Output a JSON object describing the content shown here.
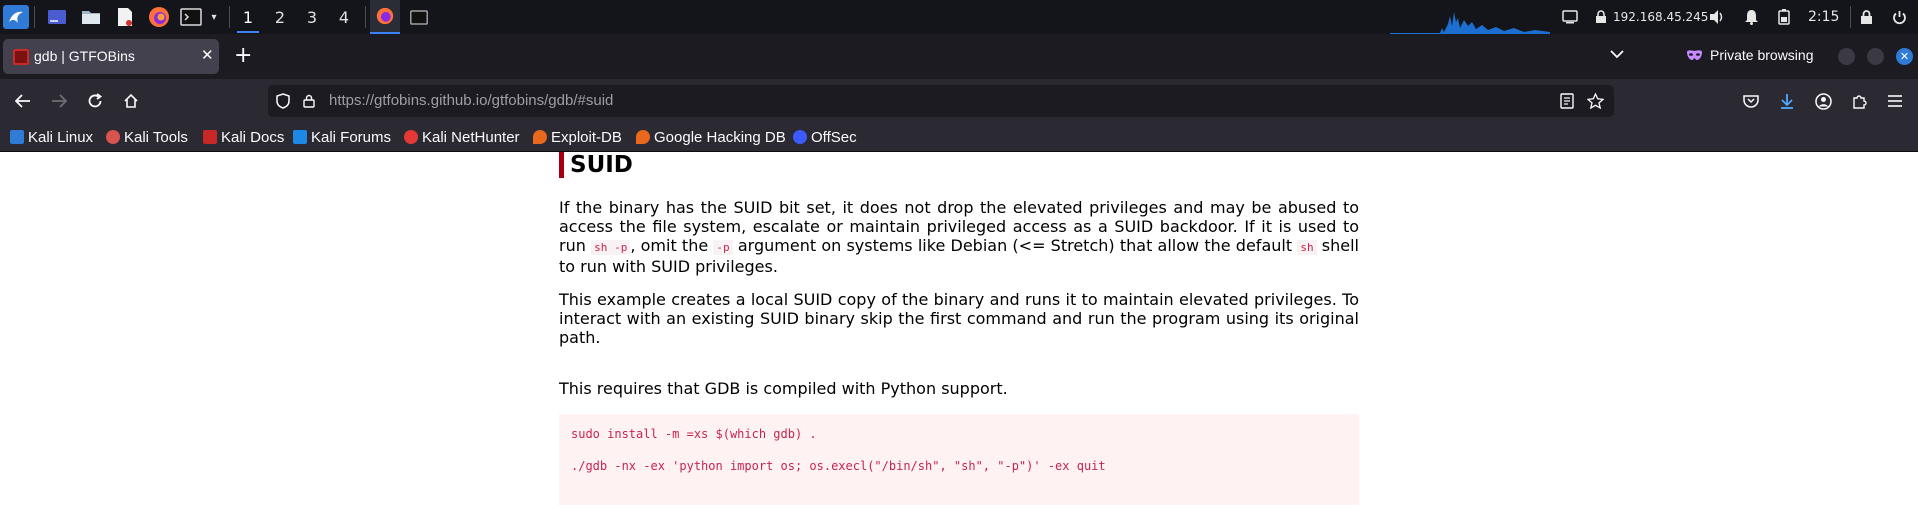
{
  "taskbar": {
    "workspaces": [
      "1",
      "2",
      "3",
      "4"
    ],
    "ip_address": "192.168.45.245",
    "clock": "2:15"
  },
  "browser": {
    "tab_title": "gdb | GTFOBins",
    "private_label": "Private browsing",
    "url_host": "https://gtfobins.github.io",
    "url_path": "/gtfobins/gdb/#suid",
    "bookmarks": [
      "Kali Linux",
      "Kali Tools",
      "Kali Docs",
      "Kali Forums",
      "Kali NetHunter",
      "Exploit-DB",
      "Google Hacking DB",
      "OffSec"
    ]
  },
  "page": {
    "heading": "SUID",
    "p1": {
      "t1": "If the binary has the SUID bit set, it does not drop the elevated privileges and may be abused to access the file system, escalate or maintain privileged access as a SUID backdoor. If it is used to run ",
      "c1": "sh -p",
      "t2": ", omit the ",
      "c2": "-p",
      "t3": " argument on systems like Debian (<= Stretch) that allow the default ",
      "c3": "sh",
      "t4": " shell to run with SUID privileges."
    },
    "p2": "This example creates a local SUID copy of the binary and runs it to maintain elevated privileges. To interact with an existing SUID binary skip the first command and run the program using its original path.",
    "p3": "This requires that GDB is compiled with Python support.",
    "code": [
      "sudo install -m =xs $(which gdb) .",
      "./gdb -nx -ex 'python import os; os.execl(\"/bin/sh\", \"sh\", \"-p\")' -ex quit"
    ]
  },
  "colors": {
    "accent_red": "#a4000f",
    "code_text": "#c7254e",
    "code_bg": "#fff2f2",
    "browser_dark": "#2b2a33"
  }
}
